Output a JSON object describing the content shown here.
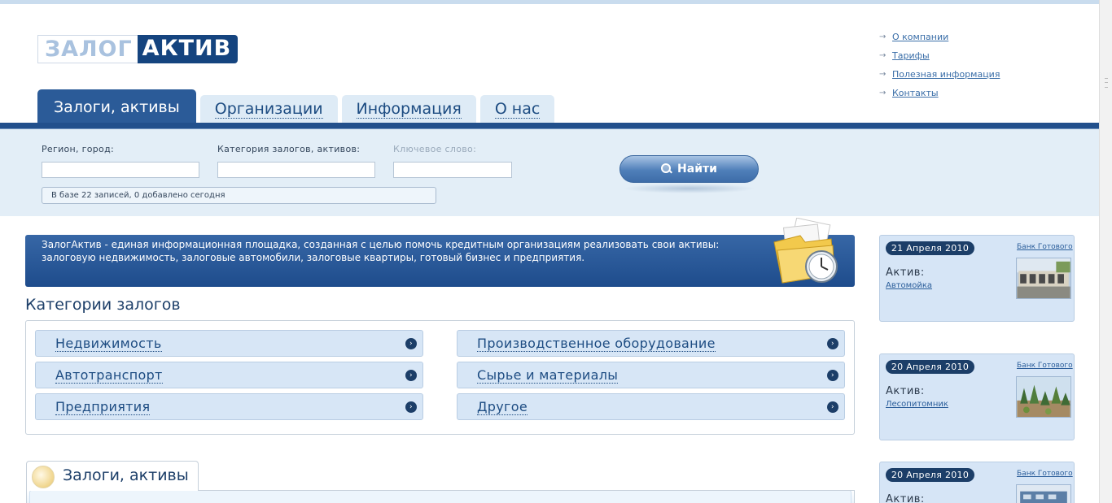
{
  "logo": {
    "part1": "ЗАЛОГ",
    "part2": "АКТИВ"
  },
  "top_links": [
    "О компании",
    "Тарифы",
    "Полезная информация",
    "Контакты"
  ],
  "tabs": [
    "Залоги, активы",
    "Организации",
    "Информация",
    "О нас"
  ],
  "search": {
    "region_label": "Регион, город:",
    "category_label": "Категория залогов, активов:",
    "keyword_label": "Ключевое слово:",
    "region_value": "",
    "category_value": "",
    "keyword_value": "",
    "button_label": "Найти",
    "count_text": "В базе 22 записей, 0 добавлено сегодня"
  },
  "banner_text": "ЗалогАктив - единая информационная площадка, созданная с целью помочь кредитным организациям реализовать свои активы: залоговую недвижимость, залоговые автомобили, залоговые квартиры, готовый бизнес и предприятия.",
  "categories": {
    "title": "Категории залогов",
    "items": [
      "Недвижимость",
      "Производственное оборудование",
      "Автотранспорт",
      "Сырье и материалы",
      "Предприятия",
      "Другое"
    ]
  },
  "section_tab": "Залоги, активы",
  "news": [
    {
      "date": "21 Апреля 2010",
      "bank": "Банк Готового",
      "label": "Актив:",
      "link": "Автомойка"
    },
    {
      "date": "20 Апреля 2010",
      "bank": "Банк Готового",
      "label": "Актив:",
      "link": "Лесопитомник"
    },
    {
      "date": "20 Апреля 2010",
      "bank": "Банк Готового",
      "label": "Актив:",
      "link": ""
    }
  ],
  "colors": {
    "brand_dark": "#15447f",
    "tab_active": "#2b5b98",
    "panel": "#e3eef7",
    "card": "#d6e5f6",
    "date_badge": "#1c3e68"
  }
}
